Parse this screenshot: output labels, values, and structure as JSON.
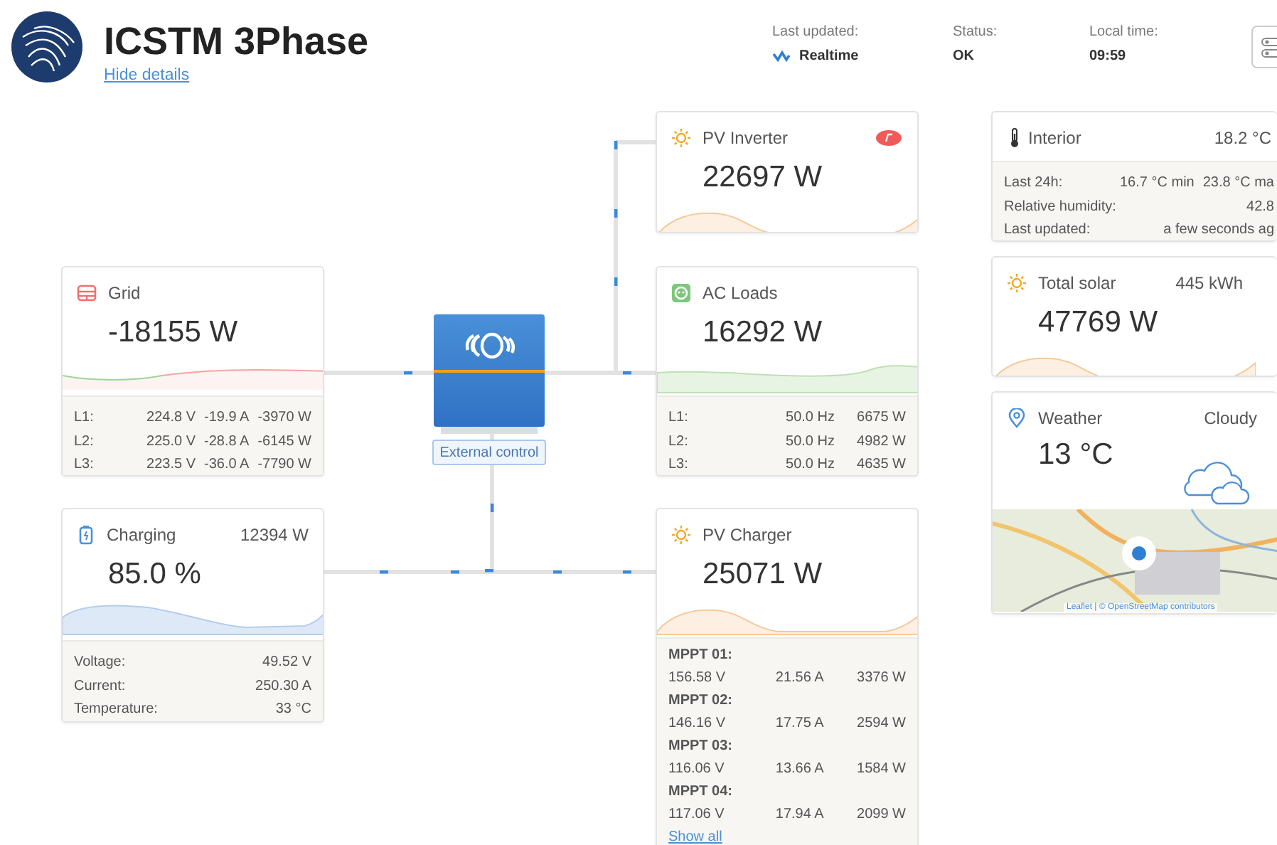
{
  "header": {
    "title": "ICSTM 3Phase",
    "hide_details": "Hide details",
    "status_items": [
      {
        "label": "Last updated:",
        "value": "Realtime",
        "kind": "realtime"
      },
      {
        "label": "Status:",
        "value": "OK",
        "kind": "plain"
      },
      {
        "label": "Local time:",
        "value": "09:59",
        "kind": "plain"
      }
    ]
  },
  "grid": {
    "title": "Grid",
    "value": "-18155 W",
    "rows": [
      {
        "label": "L1:",
        "cells": [
          "224.8 V",
          "-19.9 A",
          "-3970 W"
        ]
      },
      {
        "label": "L2:",
        "cells": [
          "225.0 V",
          "-28.8 A",
          "-6145 W"
        ]
      },
      {
        "label": "L3:",
        "cells": [
          "223.5 V",
          "-36.0 A",
          "-7790 W"
        ]
      }
    ]
  },
  "inverter": {
    "label": "External control"
  },
  "pv_inverter": {
    "title": "PV Inverter",
    "value": "22697 W"
  },
  "ac_loads": {
    "title": "AC Loads",
    "value": "16292 W",
    "rows": [
      {
        "label": "L1:",
        "cells": [
          "50.0 Hz",
          "6675 W"
        ]
      },
      {
        "label": "L2:",
        "cells": [
          "50.0 Hz",
          "4982 W"
        ]
      },
      {
        "label": "L3:",
        "cells": [
          "50.0 Hz",
          "4635 W"
        ]
      }
    ]
  },
  "battery": {
    "title": "Charging",
    "power": "12394 W",
    "value": "85.0 %",
    "rows": [
      {
        "label": "Voltage:",
        "cells": [
          "49.52 V"
        ]
      },
      {
        "label": "Current:",
        "cells": [
          "250.30 A"
        ]
      },
      {
        "label": "Temperature:",
        "cells": [
          "33 °C"
        ]
      }
    ]
  },
  "pv_charger": {
    "title": "PV Charger",
    "value": "25071 W",
    "trackers": [
      {
        "name": "MPPT 01:",
        "cells": [
          "156.58 V",
          "21.56 A",
          "3376 W"
        ]
      },
      {
        "name": "MPPT 02:",
        "cells": [
          "146.16 V",
          "17.75 A",
          "2594 W"
        ]
      },
      {
        "name": "MPPT 03:",
        "cells": [
          "116.06 V",
          "13.66 A",
          "1584 W"
        ]
      },
      {
        "name": "MPPT 04:",
        "cells": [
          "117.06 V",
          "17.94 A",
          "2099 W"
        ]
      }
    ],
    "show_all": "Show all"
  },
  "interior": {
    "title": "Interior",
    "value": "18.2 °C",
    "rows": [
      {
        "label": "Last 24h:",
        "cells": [
          "16.7 °C min",
          "23.8 °C ma"
        ]
      },
      {
        "label": "Relative humidity:",
        "cells": [
          "42.8"
        ]
      },
      {
        "label": "Last updated:",
        "cells": [
          "a few seconds ag"
        ]
      }
    ]
  },
  "total_solar": {
    "title": "Total solar",
    "energy": "445 kWh",
    "value": "47769 W"
  },
  "weather": {
    "title": "Weather",
    "condition": "Cloudy",
    "value": "13 °C",
    "attribution": "Leaflet | © OpenStreetMap contributors"
  }
}
